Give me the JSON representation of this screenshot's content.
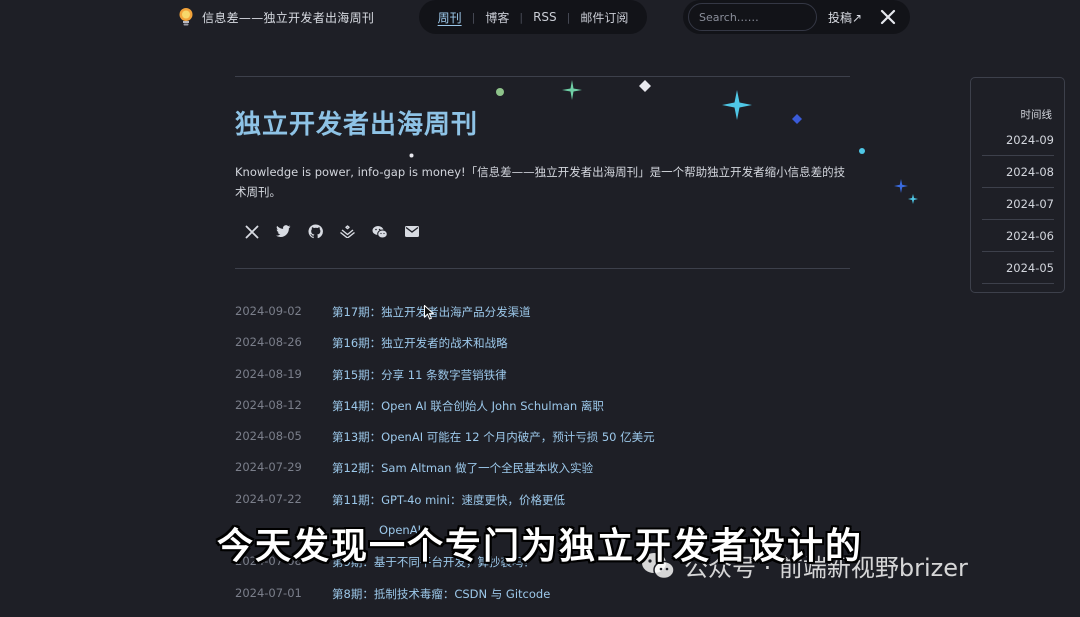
{
  "brand": {
    "name": "信息差——独立开发者出海周刊",
    "logo_icon": "lightbulb-icon"
  },
  "nav": {
    "items": [
      {
        "label": "周刊",
        "active": true
      },
      {
        "label": "博客"
      },
      {
        "label": "RSS"
      },
      {
        "label": "邮件订阅"
      }
    ]
  },
  "search": {
    "placeholder": "Search……"
  },
  "submit": {
    "label": "投稿↗"
  },
  "page": {
    "title": "独立开发者出海周刊",
    "description": "Knowledge is power, info-gap is money!「信息差——独立开发者出海周刊」是一个帮助独立开发者缩小信息差的技术周刊。"
  },
  "socials": [
    "x-icon",
    "twitter-icon",
    "github-icon",
    "juejin-icon",
    "wechat-icon",
    "mail-icon"
  ],
  "posts": [
    {
      "date": "2024-09-02",
      "title": "第17期：独立开发者出海产品分发渠道"
    },
    {
      "date": "2024-08-26",
      "title": "第16期：独立开发者的战术和战略"
    },
    {
      "date": "2024-08-19",
      "title": "第15期：分享 11 条数字营销铁律"
    },
    {
      "date": "2024-08-12",
      "title": "第14期：Open AI 联合创始人 John Schulman 离职"
    },
    {
      "date": "2024-08-05",
      "title": "第13期：OpenAI 可能在 12 个月内破产，预计亏损 50 亿美元"
    },
    {
      "date": "2024-07-29",
      "title": "第12期：Sam Altman 做了一个全民基本收入实验"
    },
    {
      "date": "2024-07-22",
      "title": "第11期：GPT-4o mini：速度更快，价格更低"
    },
    {
      "date": "",
      "title": "OpenAI"
    },
    {
      "date": "2024-07-08",
      "title": "第9期：基于不同平台开发，算抄袭吗？"
    },
    {
      "date": "2024-07-01",
      "title": "第8期：抵制技术毒瘤：CSDN 与 Gitcode"
    }
  ],
  "timeline": {
    "title": "时间线",
    "items": [
      "2024-09",
      "2024-08",
      "2024-07",
      "2024-06",
      "2024-05"
    ]
  },
  "overlay": {
    "subtitle": "今天发现一个专门为独立开发者设计的",
    "watermark": "公众号 · 前端新视野brizer"
  },
  "colors": {
    "background": "#1e1f26",
    "accent": "#8ec3e6",
    "link": "#9cc8ea"
  }
}
